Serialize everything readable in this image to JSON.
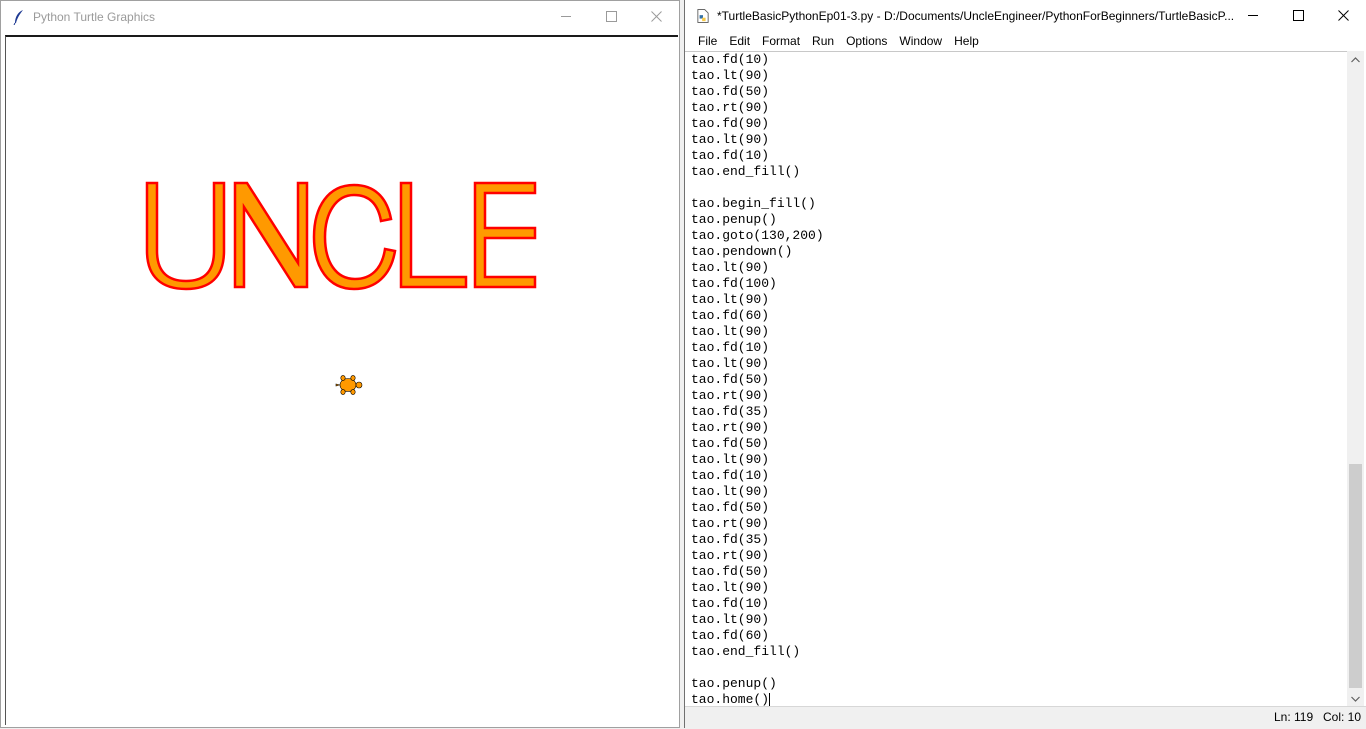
{
  "turtle_window": {
    "title": "Python Turtle Graphics",
    "icon": "feather-icon",
    "canvas": {
      "drawn_text": "UNCLE",
      "letter_fill": "#ff9900",
      "letter_outline": "#ff0000",
      "turtle_fill": "#ff9900"
    }
  },
  "idle_window": {
    "title": "*TurtleBasicPythonEp01-3.py - D:/Documents/UncleEngineer/PythonForBeginners/TurtleBasicP...",
    "icon": "python-file-icon",
    "menu": [
      "File",
      "Edit",
      "Format",
      "Run",
      "Options",
      "Window",
      "Help"
    ],
    "code_lines": [
      "tao.fd(10)",
      "tao.lt(90)",
      "tao.fd(50)",
      "tao.rt(90)",
      "tao.fd(90)",
      "tao.lt(90)",
      "tao.fd(10)",
      "tao.end_fill()",
      "",
      "tao.begin_fill()",
      "tao.penup()",
      "tao.goto(130,200)",
      "tao.pendown()",
      "tao.lt(90)",
      "tao.fd(100)",
      "tao.lt(90)",
      "tao.fd(60)",
      "tao.lt(90)",
      "tao.fd(10)",
      "tao.lt(90)",
      "tao.fd(50)",
      "tao.rt(90)",
      "tao.fd(35)",
      "tao.rt(90)",
      "tao.fd(50)",
      "tao.lt(90)",
      "tao.fd(10)",
      "tao.lt(90)",
      "tao.fd(50)",
      "tao.rt(90)",
      "tao.fd(35)",
      "tao.rt(90)",
      "tao.fd(50)",
      "tao.lt(90)",
      "tao.fd(10)",
      "tao.lt(90)",
      "tao.fd(60)",
      "tao.end_fill()",
      "",
      "tao.penup()",
      "tao.home()"
    ],
    "status": {
      "line": "Ln: 119",
      "col": "Col: 10"
    }
  }
}
